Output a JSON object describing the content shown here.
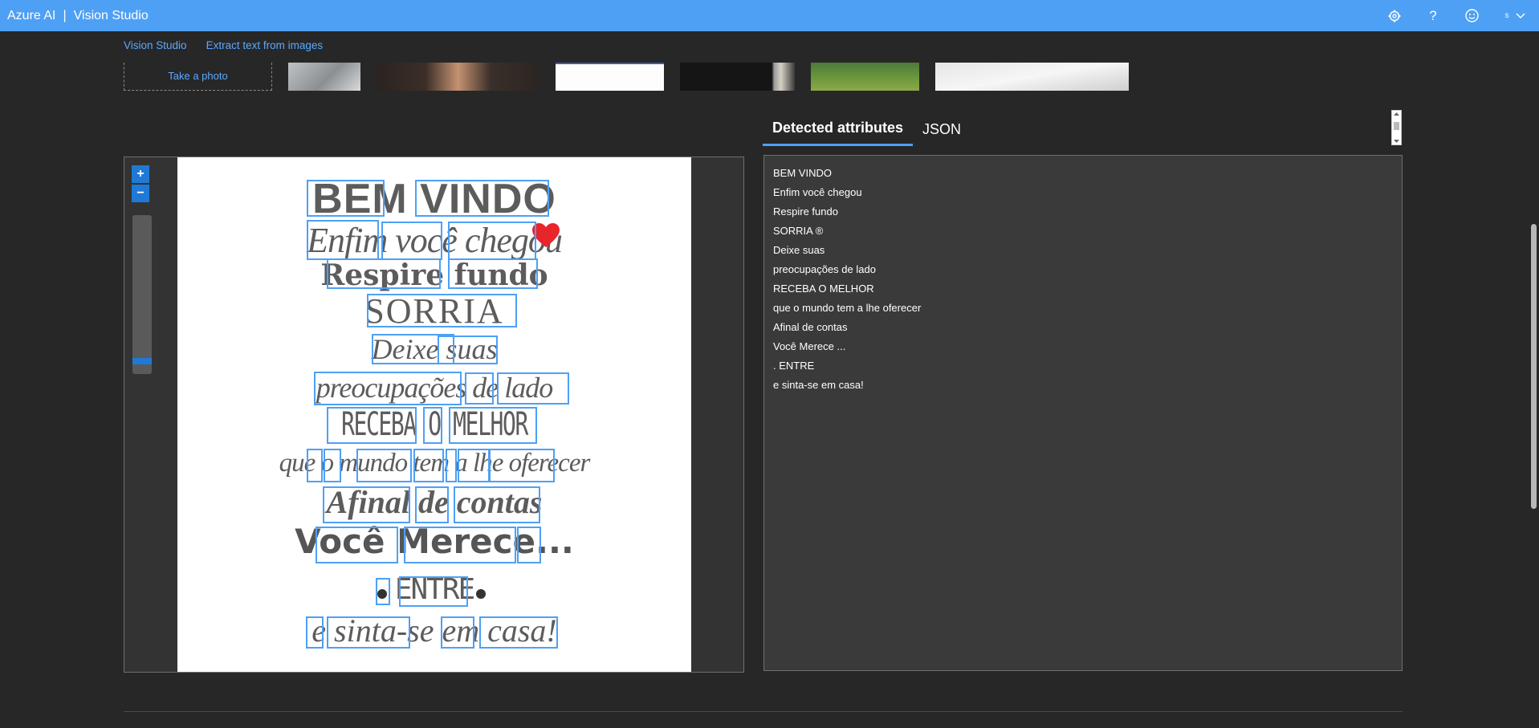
{
  "app": {
    "brand": "Azure AI",
    "separator": "|",
    "product": "Vision Studio"
  },
  "topbar_icons": [
    "gear-icon",
    "help-icon",
    "smiley-icon"
  ],
  "user": {
    "initial": "s"
  },
  "breadcrumb": [
    "Vision Studio",
    "Extract text from images"
  ],
  "take_photo_label": "Take a photo",
  "tabs": [
    "Detected attributes",
    "JSON"
  ],
  "detected_lines": [
    "BEM VINDO",
    "Enfim você chegou",
    "Respire fundo",
    "SORRIA ®",
    "Deixe suas",
    "preocupações de lado",
    "RECEBA O MELHOR",
    "que o mundo tem a lhe oferecer",
    "Afinal de contas",
    "Você Merece ...",
    ". ENTRE",
    "e sinta-se em casa!"
  ],
  "zoom": {
    "in_label": "+",
    "out_label": "−",
    "level": 0.05
  },
  "image_text": {
    "l1": "BEM VINDO",
    "l2": "Enfim você chegou",
    "l3": "Respire fundo",
    "l4": "SORRIA",
    "l5": "Deixe suas",
    "l6": "preocupações de lado",
    "l7": "RECEBA O MELHOR",
    "l8": "que o mundo tem a lhe oferecer",
    "l9": "Afinal de contas",
    "l10": "Você Merece...",
    "l11": "ENTRE",
    "l12": "e sinta-se em casa!"
  },
  "colors": {
    "accent": "#4ea0f5",
    "link": "#5aa9ff",
    "heart": "#e8252b"
  }
}
